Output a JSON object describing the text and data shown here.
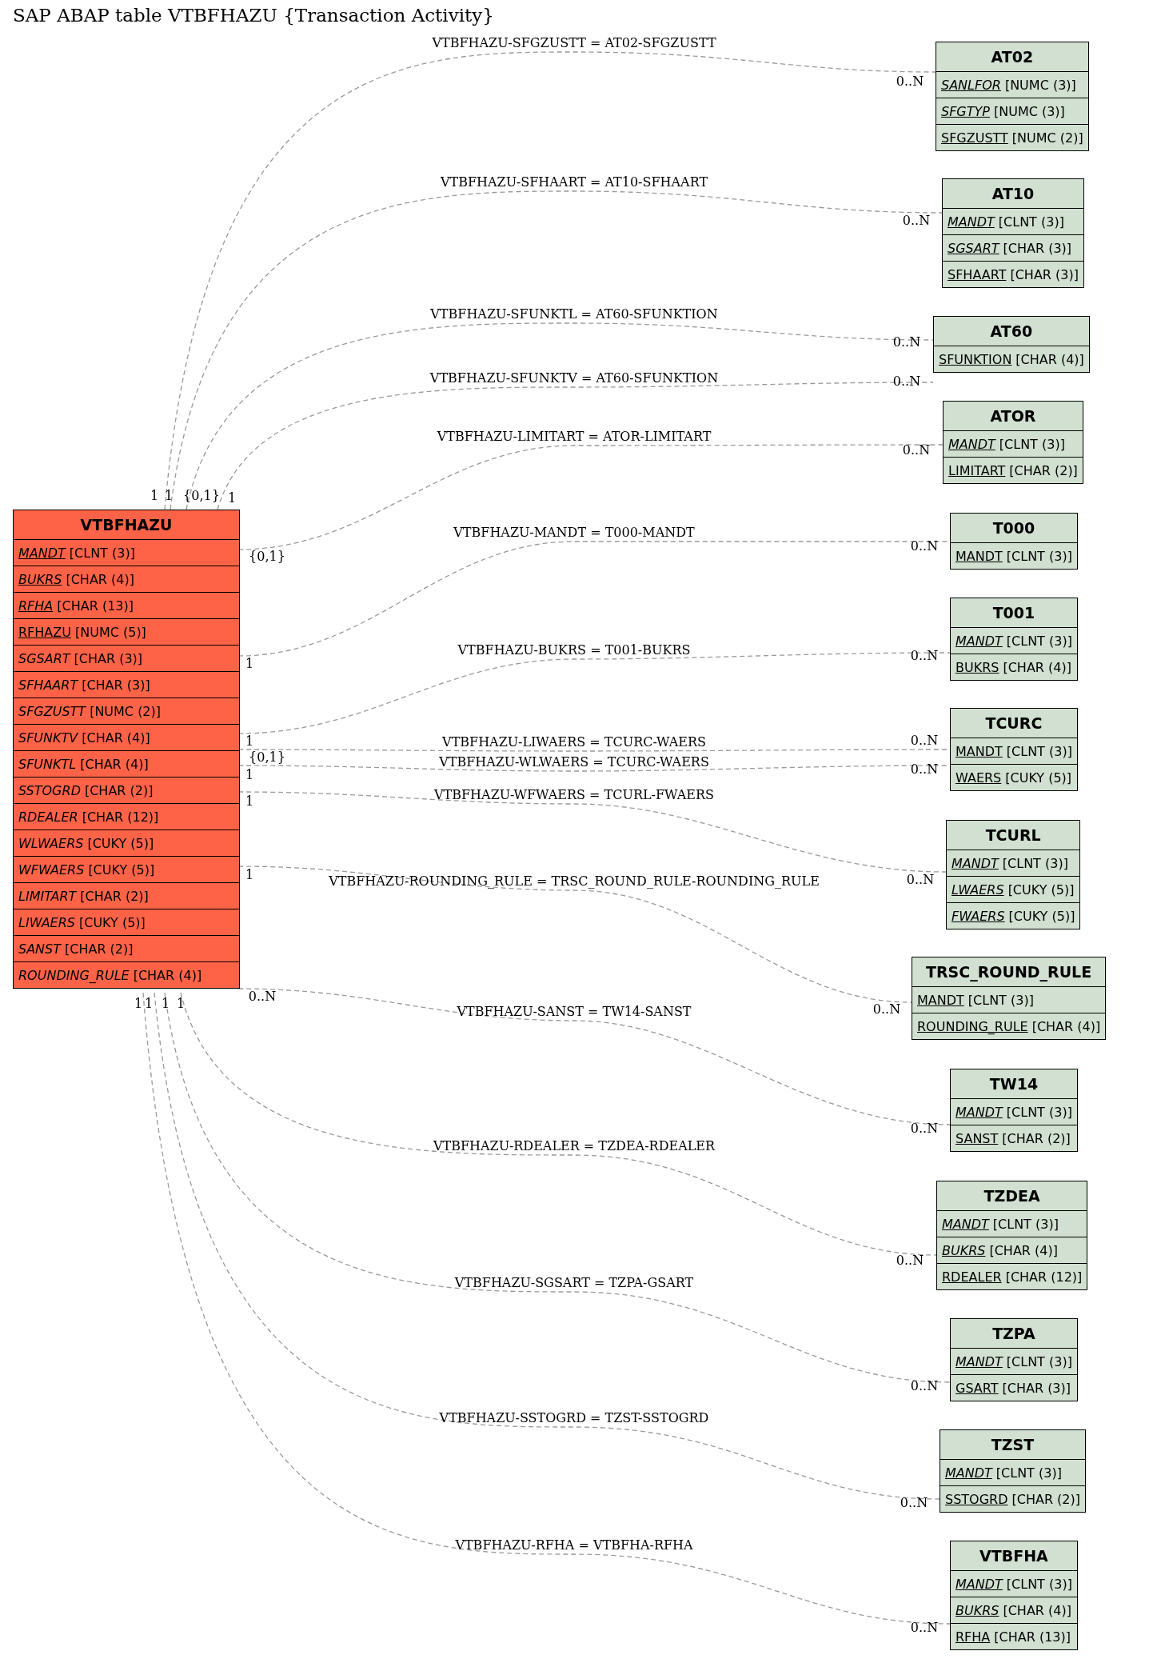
{
  "title": "SAP ABAP table VTBFHAZU {Transaction Activity}",
  "main_table": {
    "name": "VTBFHAZU",
    "fields": [
      {
        "name": "MANDT",
        "type": "[CLNT (3)]",
        "key": true,
        "italic": true
      },
      {
        "name": "BUKRS",
        "type": "[CHAR (4)]",
        "key": true,
        "italic": true
      },
      {
        "name": "RFHA",
        "type": "[CHAR (13)]",
        "key": true,
        "italic": true
      },
      {
        "name": "RFHAZU",
        "type": "[NUMC (5)]",
        "key": true,
        "italic": false
      },
      {
        "name": "SGSART",
        "type": "[CHAR (3)]",
        "key": false,
        "italic": true
      },
      {
        "name": "SFHAART",
        "type": "[CHAR (3)]",
        "key": false,
        "italic": true
      },
      {
        "name": "SFGZUSTT",
        "type": "[NUMC (2)]",
        "key": false,
        "italic": true
      },
      {
        "name": "SFUNKTV",
        "type": "[CHAR (4)]",
        "key": false,
        "italic": true
      },
      {
        "name": "SFUNKTL",
        "type": "[CHAR (4)]",
        "key": false,
        "italic": true
      },
      {
        "name": "SSTOGRD",
        "type": "[CHAR (2)]",
        "key": false,
        "italic": true
      },
      {
        "name": "RDEALER",
        "type": "[CHAR (12)]",
        "key": false,
        "italic": true
      },
      {
        "name": "WLWAERS",
        "type": "[CUKY (5)]",
        "key": false,
        "italic": true
      },
      {
        "name": "WFWAERS",
        "type": "[CUKY (5)]",
        "key": false,
        "italic": true
      },
      {
        "name": "LIMITART",
        "type": "[CHAR (2)]",
        "key": false,
        "italic": true
      },
      {
        "name": "LIWAERS",
        "type": "[CUKY (5)]",
        "key": false,
        "italic": true
      },
      {
        "name": "SANST",
        "type": "[CHAR (2)]",
        "key": false,
        "italic": true
      },
      {
        "name": "ROUNDING_RULE",
        "type": "[CHAR (4)]",
        "key": false,
        "italic": true
      }
    ]
  },
  "tables": [
    {
      "name": "AT02",
      "fields": [
        {
          "name": "SANLFOR",
          "type": "[NUMC (3)]",
          "key": true,
          "italic": true
        },
        {
          "name": "SFGTYP",
          "type": "[NUMC (3)]",
          "key": true,
          "italic": true
        },
        {
          "name": "SFGZUSTT",
          "type": "[NUMC (2)]",
          "key": true,
          "italic": false
        }
      ]
    },
    {
      "name": "AT10",
      "fields": [
        {
          "name": "MANDT",
          "type": "[CLNT (3)]",
          "key": true,
          "italic": true
        },
        {
          "name": "SGSART",
          "type": "[CHAR (3)]",
          "key": true,
          "italic": true
        },
        {
          "name": "SFHAART",
          "type": "[CHAR (3)]",
          "key": true,
          "italic": false
        }
      ]
    },
    {
      "name": "AT60",
      "fields": [
        {
          "name": "SFUNKTION",
          "type": "[CHAR (4)]",
          "key": true,
          "italic": false
        }
      ]
    },
    {
      "name": "ATOR",
      "fields": [
        {
          "name": "MANDT",
          "type": "[CLNT (3)]",
          "key": true,
          "italic": true
        },
        {
          "name": "LIMITART",
          "type": "[CHAR (2)]",
          "key": true,
          "italic": false
        }
      ]
    },
    {
      "name": "T000",
      "fields": [
        {
          "name": "MANDT",
          "type": "[CLNT (3)]",
          "key": true,
          "italic": false
        }
      ]
    },
    {
      "name": "T001",
      "fields": [
        {
          "name": "MANDT",
          "type": "[CLNT (3)]",
          "key": true,
          "italic": true
        },
        {
          "name": "BUKRS",
          "type": "[CHAR (4)]",
          "key": true,
          "italic": false
        }
      ]
    },
    {
      "name": "TCURC",
      "fields": [
        {
          "name": "MANDT",
          "type": "[CLNT (3)]",
          "key": true,
          "italic": false
        },
        {
          "name": "WAERS",
          "type": "[CUKY (5)]",
          "key": true,
          "italic": false
        }
      ]
    },
    {
      "name": "TCURL",
      "fields": [
        {
          "name": "MANDT",
          "type": "[CLNT (3)]",
          "key": true,
          "italic": true
        },
        {
          "name": "LWAERS",
          "type": "[CUKY (5)]",
          "key": true,
          "italic": true
        },
        {
          "name": "FWAERS",
          "type": "[CUKY (5)]",
          "key": true,
          "italic": true
        }
      ]
    },
    {
      "name": "TRSC_ROUND_RULE",
      "fields": [
        {
          "name": "MANDT",
          "type": "[CLNT (3)]",
          "key": true,
          "italic": false
        },
        {
          "name": "ROUNDING_RULE",
          "type": "[CHAR (4)]",
          "key": true,
          "italic": false
        }
      ]
    },
    {
      "name": "TW14",
      "fields": [
        {
          "name": "MANDT",
          "type": "[CLNT (3)]",
          "key": true,
          "italic": true
        },
        {
          "name": "SANST",
          "type": "[CHAR (2)]",
          "key": true,
          "italic": false
        }
      ]
    },
    {
      "name": "TZDEA",
      "fields": [
        {
          "name": "MANDT",
          "type": "[CLNT (3)]",
          "key": true,
          "italic": true
        },
        {
          "name": "BUKRS",
          "type": "[CHAR (4)]",
          "key": true,
          "italic": true
        },
        {
          "name": "RDEALER",
          "type": "[CHAR (12)]",
          "key": true,
          "italic": false
        }
      ]
    },
    {
      "name": "TZPA",
      "fields": [
        {
          "name": "MANDT",
          "type": "[CLNT (3)]",
          "key": true,
          "italic": true
        },
        {
          "name": "GSART",
          "type": "[CHAR (3)]",
          "key": true,
          "italic": false
        }
      ]
    },
    {
      "name": "TZST",
      "fields": [
        {
          "name": "MANDT",
          "type": "[CLNT (3)]",
          "key": true,
          "italic": true
        },
        {
          "name": "SSTOGRD",
          "type": "[CHAR (2)]",
          "key": true,
          "italic": false
        }
      ]
    },
    {
      "name": "VTBFHA",
      "fields": [
        {
          "name": "MANDT",
          "type": "[CLNT (3)]",
          "key": true,
          "italic": true
        },
        {
          "name": "BUKRS",
          "type": "[CHAR (4)]",
          "key": true,
          "italic": true
        },
        {
          "name": "RFHA",
          "type": "[CHAR (13)]",
          "key": true,
          "italic": false
        }
      ]
    }
  ],
  "relations": [
    {
      "label": "VTBFHAZU-SFGZUSTT = AT02-SFGZUSTT",
      "from_card": "1",
      "to_card": "0..N"
    },
    {
      "label": "VTBFHAZU-SFHAART = AT10-SFHAART",
      "from_card": "1",
      "to_card": "0..N"
    },
    {
      "label": "VTBFHAZU-SFUNKTL = AT60-SFUNKTION",
      "from_card": "{0,1}",
      "to_card": "0..N"
    },
    {
      "label": "VTBFHAZU-SFUNKTV = AT60-SFUNKTION",
      "from_card": "1",
      "to_card": "0..N"
    },
    {
      "label": "VTBFHAZU-LIMITART = ATOR-LIMITART",
      "from_card": "{0,1}",
      "to_card": "0..N"
    },
    {
      "label": "VTBFHAZU-MANDT = T000-MANDT",
      "from_card": "1",
      "to_card": "0..N"
    },
    {
      "label": "VTBFHAZU-BUKRS = T001-BUKRS",
      "from_card": "1",
      "to_card": "0..N"
    },
    {
      "label": "VTBFHAZU-LIWAERS = TCURC-WAERS",
      "from_card": "{0,1}",
      "to_card": "0..N"
    },
    {
      "label": "VTBFHAZU-WLWAERS = TCURC-WAERS",
      "from_card": "1",
      "to_card": "0..N"
    },
    {
      "label": "VTBFHAZU-WFWAERS = TCURL-FWAERS",
      "from_card": "1",
      "to_card": "0..N"
    },
    {
      "label": "VTBFHAZU-ROUNDING_RULE = TRSC_ROUND_RULE-ROUNDING_RULE",
      "from_card": "1",
      "to_card": "0..N"
    },
    {
      "label": "VTBFHAZU-SANST = TW14-SANST",
      "from_card": "0..N",
      "to_card": "0..N"
    },
    {
      "label": "VTBFHAZU-RDEALER = TZDEA-RDEALER",
      "from_card": "1",
      "to_card": "0..N"
    },
    {
      "label": "VTBFHAZU-SGSART = TZPA-GSART",
      "from_card": "1",
      "to_card": "0..N"
    },
    {
      "label": "VTBFHAZU-SSTOGRD = TZST-SSTOGRD",
      "from_card": "1",
      "to_card": "0..N"
    },
    {
      "label": "VTBFHAZU-RFHA = VTBFHA-RFHA",
      "from_card": "1",
      "to_card": "0..N"
    }
  ]
}
